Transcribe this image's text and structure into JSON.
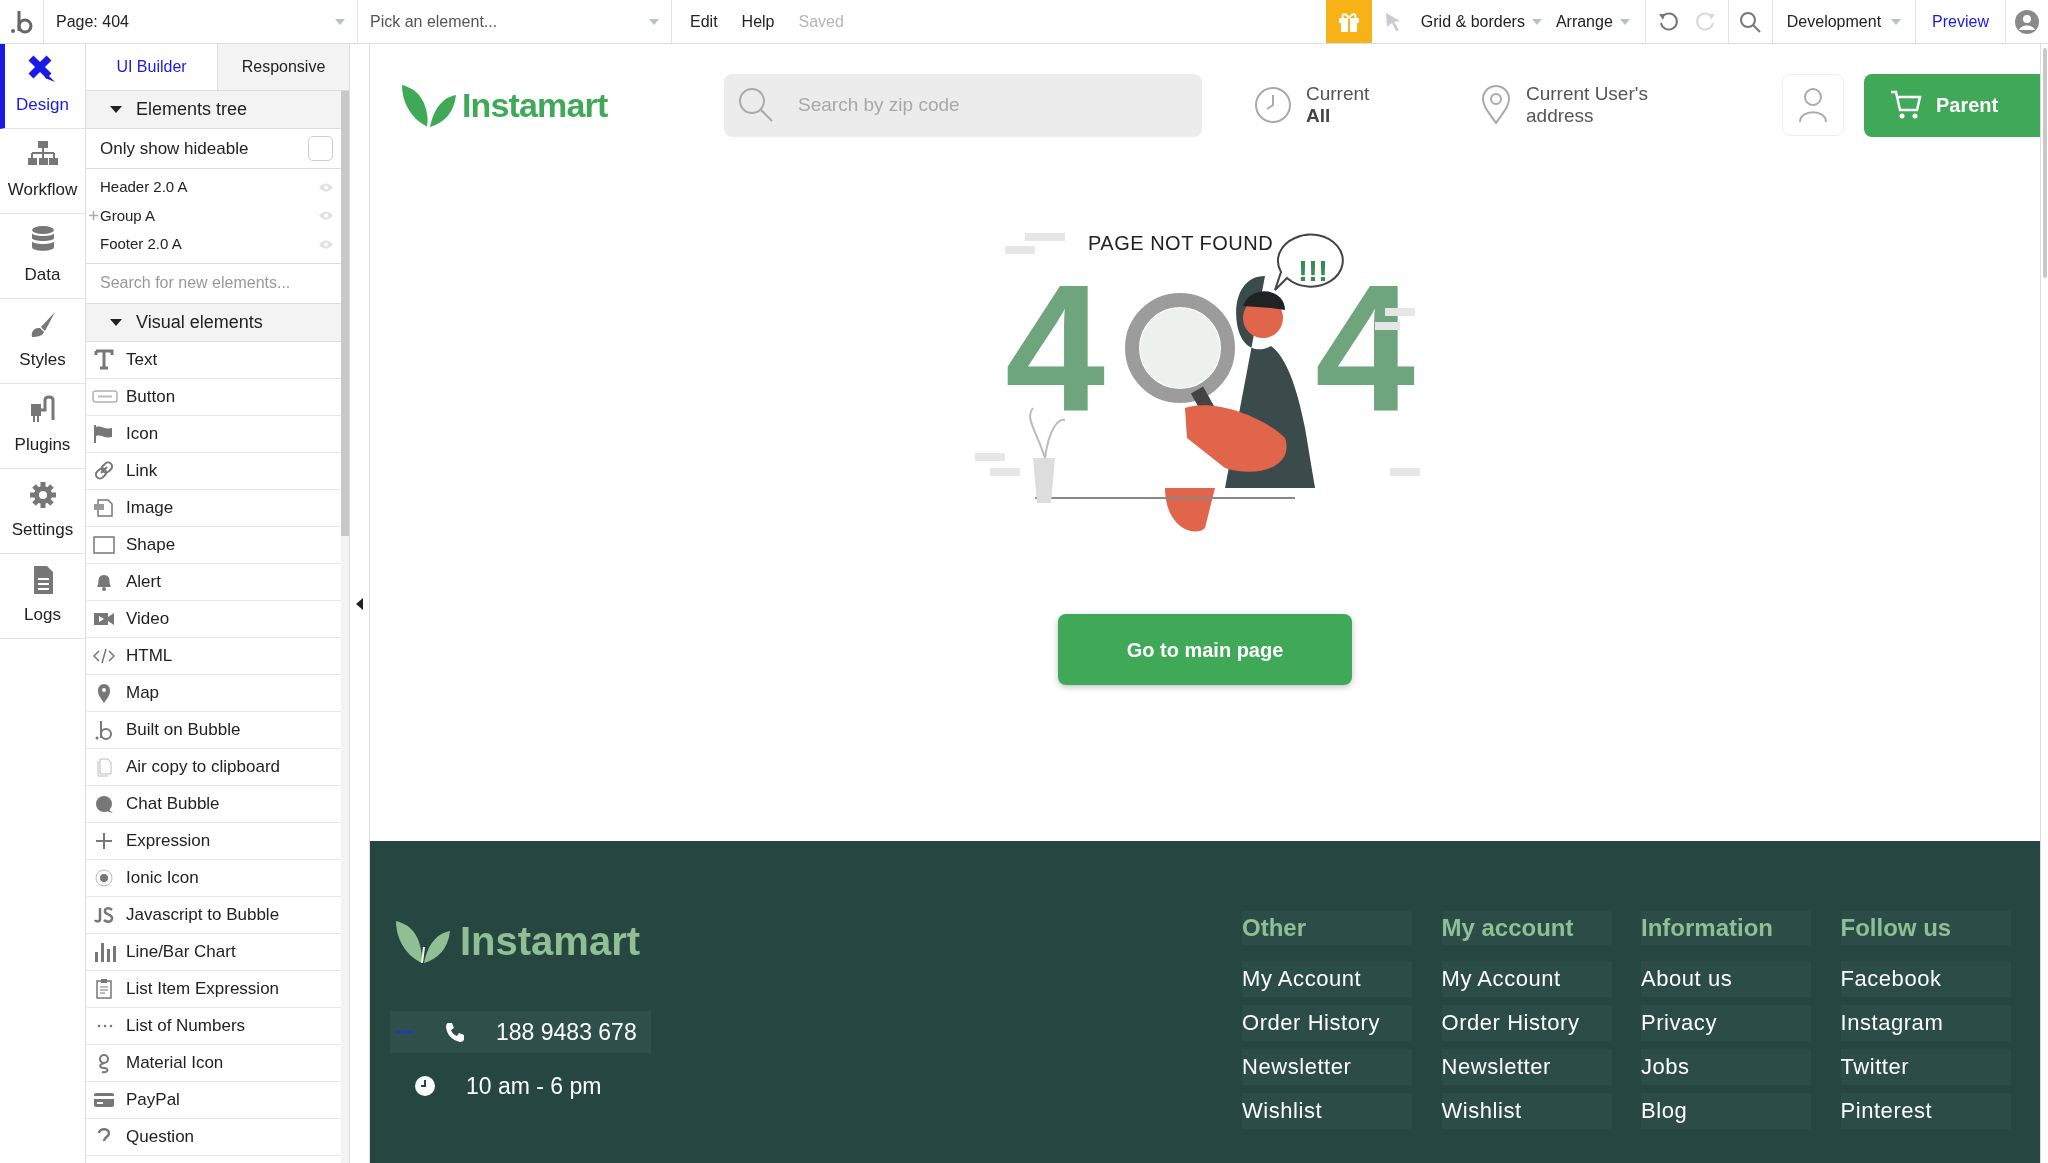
{
  "topbar": {
    "page": "Page: 404",
    "picker_placeholder": "Pick an element...",
    "menus": [
      {
        "label": "Edit",
        "disabled": false
      },
      {
        "label": "Help",
        "disabled": false
      },
      {
        "label": "Saved",
        "disabled": true
      }
    ],
    "tools": [
      {
        "label": "Grid & borders"
      },
      {
        "label": "Arrange"
      }
    ],
    "redo_disabled": true,
    "environment": "Development",
    "preview": "Preview"
  },
  "rail": [
    {
      "label": "Design",
      "selected": true
    },
    {
      "label": "Workflow",
      "selected": false
    },
    {
      "label": "Data",
      "selected": false
    },
    {
      "label": "Styles",
      "selected": false
    },
    {
      "label": "Plugins",
      "selected": false
    },
    {
      "label": "Settings",
      "selected": false
    },
    {
      "label": "Logs",
      "selected": false
    }
  ],
  "panel_tabs": [
    {
      "label": "UI Builder",
      "selected": true
    },
    {
      "label": "Responsive",
      "selected": false
    }
  ],
  "elements_tree": {
    "title": "Elements tree",
    "expanded": true,
    "filter": {
      "label": "Only show hideable",
      "checked": false
    },
    "items": [
      {
        "label": "Header 2.0 A",
        "kind": "element"
      },
      {
        "label": "Group A",
        "kind": "group"
      },
      {
        "label": "Footer 2.0 A",
        "kind": "element"
      }
    ],
    "search_placeholder": "Search for new elements..."
  },
  "visual_elements": {
    "title": "Visual elements",
    "expanded": true,
    "items": [
      "Text",
      "Button",
      "Icon",
      "Link",
      "Image",
      "Shape",
      "Alert",
      "Video",
      "HTML",
      "Map",
      "Built on Bubble",
      "Air copy to clipboard",
      "Chat Bubble",
      "Expression",
      "Ionic Icon",
      "Javascript to Bubble",
      "Line/Bar Chart",
      "List Item Expression",
      "List of Numbers",
      "Material Icon",
      "PayPal",
      "Question"
    ]
  },
  "site_header": {
    "logo": "Instamart",
    "search_placeholder": "Search by zip code",
    "time": {
      "line1": "Current",
      "line2": "All"
    },
    "address": {
      "line1": "Current User's",
      "line2": "address"
    },
    "cart": "Parent"
  },
  "not_found": {
    "caption": "PAGE NOT FOUND",
    "digits": [
      "4",
      "4"
    ],
    "bubble": "!!!",
    "button": "Go to main page"
  },
  "footer": {
    "logo": "Instamart",
    "contacts": [
      {
        "text": "188 9483 678",
        "kind": "phone"
      },
      {
        "text": "10 am - 6 pm",
        "kind": "hours"
      }
    ],
    "columns": [
      {
        "title": "Other",
        "links": [
          "My Account",
          "Order History",
          "Newsletter",
          "Wishlist"
        ]
      },
      {
        "title": "My account",
        "links": [
          "My Account",
          "Order History",
          "Newsletter",
          "Wishlist"
        ]
      },
      {
        "title": "Information",
        "links": [
          "About us",
          "Privacy",
          "Jobs",
          "Blog"
        ]
      },
      {
        "title": "Follow us",
        "links": [
          "Facebook",
          "Instagram",
          "Twitter",
          "Pinterest"
        ]
      }
    ]
  }
}
